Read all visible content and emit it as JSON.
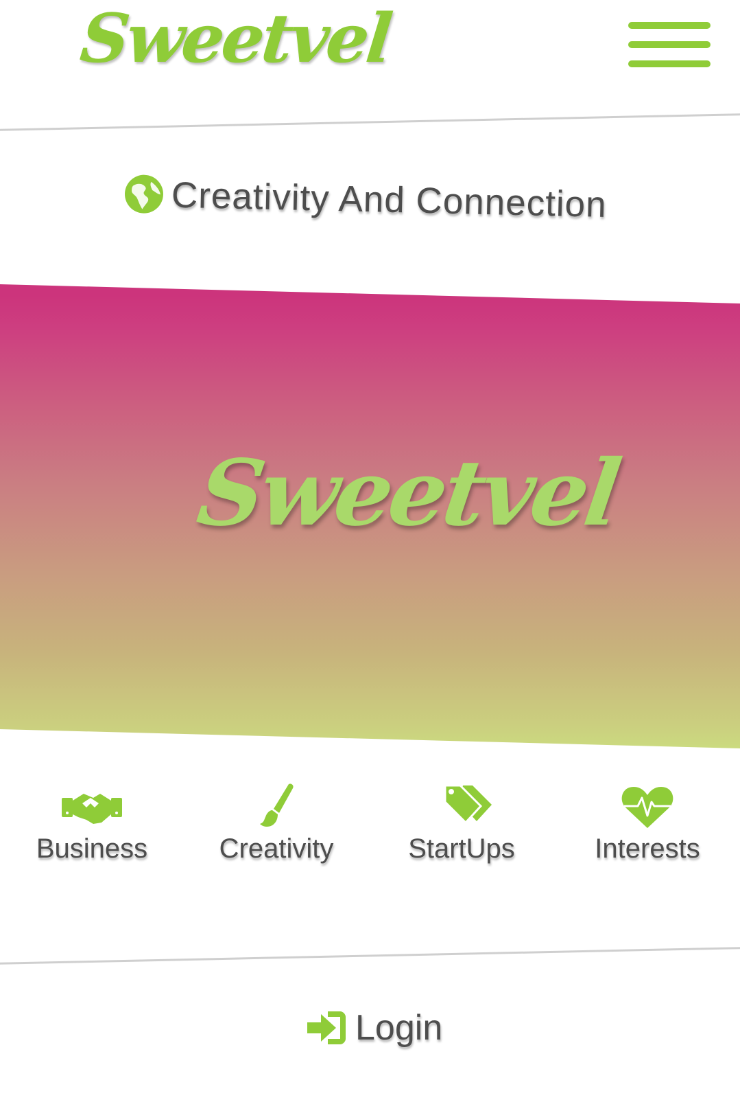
{
  "header": {
    "brand": "Sweetvel",
    "menu_icon": "hamburger-menu-icon"
  },
  "tagline": {
    "icon": "globe-icon",
    "text": "Creativity And Connection"
  },
  "hero": {
    "logo_text": "Sweetvel",
    "gradient_top": "#cc347c",
    "gradient_bottom": "#cbdb7f"
  },
  "categories": [
    {
      "label": "Business",
      "icon": "handshake-icon"
    },
    {
      "label": "Creativity",
      "icon": "paintbrush-icon"
    },
    {
      "label": "StartUps",
      "icon": "tags-icon"
    },
    {
      "label": "Interests",
      "icon": "heartbeat-icon"
    }
  ],
  "login": {
    "label": "Login",
    "icon": "sign-in-icon"
  },
  "colors": {
    "accent": "#8fcc38",
    "text": "#4d4d4d",
    "divider": "#cfcfcf"
  }
}
